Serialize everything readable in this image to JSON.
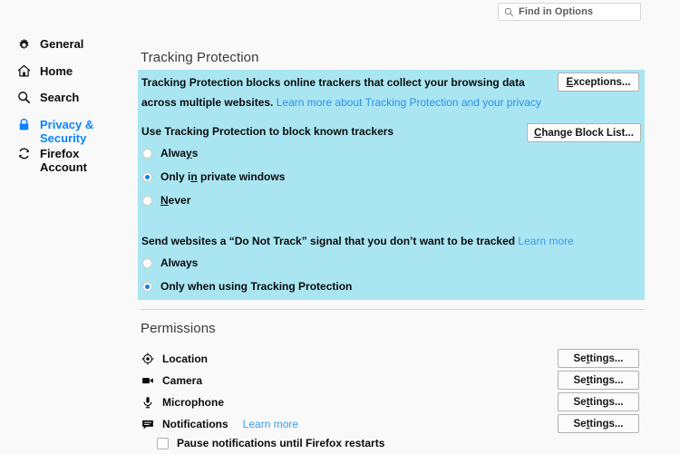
{
  "search": {
    "placeholder": "Find in Options",
    "icon": "search-icon"
  },
  "sidebar": {
    "items": [
      {
        "label": "General",
        "icon": "gear-icon",
        "selected": false
      },
      {
        "label": "Home",
        "icon": "home-icon",
        "selected": false
      },
      {
        "label": "Search",
        "icon": "search-icon",
        "selected": false
      },
      {
        "label": "Privacy &\nSecurity",
        "icon": "lock-icon",
        "selected": true
      },
      {
        "label": "Firefox\nAccount",
        "icon": "sync-icon",
        "selected": false
      }
    ],
    "selected_color": "#0a84ff"
  },
  "tracking": {
    "heading": "Tracking Protection",
    "panel_color": "#a9e6f2",
    "description_line1": "Tracking Protection blocks online trackers that collect your browsing data",
    "description_line2": "across multiple websites.",
    "description_link": "Learn more about Tracking Protection and your privacy",
    "exceptions_button": {
      "prefix": "",
      "accesskey": "E",
      "suffix": "xceptions..."
    },
    "block_label": "Use Tracking Protection to block known trackers",
    "change_block_list_button": {
      "prefix": "",
      "accesskey": "C",
      "suffix": "hange Block List..."
    },
    "options": [
      {
        "pre": "Alwa",
        "accesskey": "y",
        "post": "s",
        "selected": false
      },
      {
        "pre": "Only i",
        "accesskey": "n",
        "post": " private windows",
        "selected": true
      },
      {
        "pre": "",
        "accesskey": "N",
        "post": "ever",
        "selected": false
      }
    ],
    "dnt_label": "Send websites a “Do Not Track” signal that you don’t want to be tracked",
    "dnt_link": "Learn more",
    "dnt_options": [
      {
        "label": "Always",
        "selected": false
      },
      {
        "label": "Only when using Tracking Protection",
        "selected": true
      }
    ]
  },
  "permissions": {
    "heading": "Permissions",
    "rows": [
      {
        "label": "Location",
        "icon": "location-icon",
        "link": "",
        "button_pre": "Se",
        "button_ak": "t",
        "button_post": "tings..."
      },
      {
        "label": "Camera",
        "icon": "camera-icon",
        "link": "",
        "button_pre": "Se",
        "button_ak": "t",
        "button_post": "tings..."
      },
      {
        "label": "Microphone",
        "icon": "microphone-icon",
        "link": "",
        "button_pre": "Se",
        "button_ak": "t",
        "button_post": "tings..."
      },
      {
        "label": "Notifications",
        "icon": "notification-icon",
        "link": "Learn more",
        "button_pre": "Se",
        "button_ak": "t",
        "button_post": "tings..."
      }
    ],
    "pause_checkbox": {
      "label": "Pause notifications until Firefox restarts",
      "checked": false
    }
  },
  "colors": {
    "background": "#f9f9f9",
    "accent": "#0a84ff",
    "link": "#3a9bea",
    "panel": "#a9e6f2"
  }
}
